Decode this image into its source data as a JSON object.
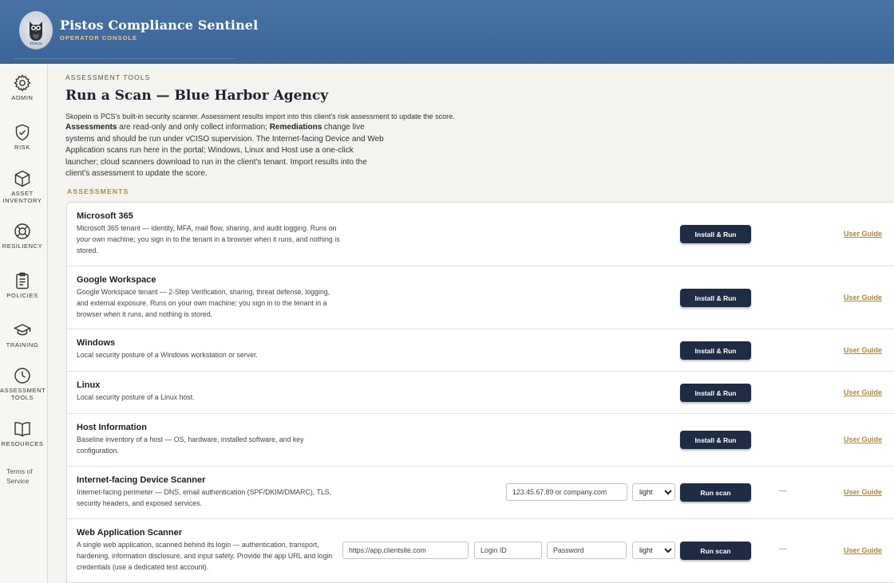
{
  "header": {
    "title": "Pistos Compliance Sentinel",
    "subtitle": "OPERATOR CONSOLE",
    "logo_text": "Pistos"
  },
  "sidebar": {
    "items": [
      {
        "label": "ADMIN",
        "icon": "gear-icon"
      },
      {
        "label": "RISK",
        "icon": "shield-check-icon"
      },
      {
        "label": "ASSET INVENTORY",
        "icon": "cube-icon"
      },
      {
        "label": "RESILIENCY",
        "icon": "lifebuoy-icon"
      },
      {
        "label": "POLICIES",
        "icon": "clipboard-icon"
      },
      {
        "label": "TRAINING",
        "icon": "graduation-cap-icon"
      },
      {
        "label": "ASSESSMENT TOOLS",
        "icon": "clock-icon"
      },
      {
        "label": "RESOURCES",
        "icon": "book-icon"
      }
    ],
    "terms": "Terms of Service"
  },
  "main": {
    "eyebrow": "ASSESSMENT TOOLS",
    "title": "Run a Scan — Blue Harbor Agency",
    "intro_line": "Skopein is PCS's built-in security scanner. Assessment results import into this client's risk assessment to update the score.",
    "intro_b1": "Assessments",
    "intro_t1": " are read-only and only collect information; ",
    "intro_b2": "Remediations",
    "intro_t2": " change live systems and should be run under vCISO supervision. The Internet-facing Device and Web Application scans run here in the portal; Windows, Linux and Host use a one-click launcher; cloud scanners download to run in the client's tenant. Import results into the client's assessment to update the score.",
    "section_label": "ASSESSMENTS",
    "rows": [
      {
        "title": "Microsoft 365",
        "desc": "Microsoft 365 tenant — identity, MFA, mail flow, sharing, and audit logging. Runs on your own machine; you sign in to the tenant in a browser when it runs, and nothing is stored.",
        "button": "Install & Run",
        "guide": "User Guide"
      },
      {
        "title": "Google Workspace",
        "desc": "Google Workspace tenant — 2-Step Verification, sharing, threat defense, logging, and external exposure. Runs on your own machine; you sign in to the tenant in a browser when it runs, and nothing is stored.",
        "button": "Install & Run",
        "guide": "User Guide"
      },
      {
        "title": "Windows",
        "desc": "Local security posture of a Windows workstation or server.",
        "button": "Install & Run",
        "guide": "User Guide"
      },
      {
        "title": "Linux",
        "desc": "Local security posture of a Linux host.",
        "button": "Install & Run",
        "guide": "User Guide"
      },
      {
        "title": "Host Information",
        "desc": "Baseline inventory of a host — OS, hardware, installed software, and key configuration.",
        "button": "Install & Run",
        "guide": "User Guide"
      },
      {
        "title": "Internet-facing Device Scanner",
        "desc": "Internet-facing perimeter — DNS, email authentication (SPF/DKIM/DMARC), TLS, security headers, and exposed services.",
        "button": "Run scan",
        "guide": "User Guide",
        "target_placeholder": "123.45.67.89 or company.com",
        "profile": "light",
        "status": "—"
      },
      {
        "title": "Web Application Scanner",
        "desc": "A single web application, scanned behind its login — authentication, transport, hardening, information disclosure, and input safety. Provide the app URL and login credentials (use a dedicated test account).",
        "button": "Run scan",
        "guide": "User Guide",
        "url_placeholder": "https://app.clientsite.com",
        "login_placeholder": "Login ID",
        "password_placeholder": "Password",
        "profile": "light",
        "status": "—"
      }
    ]
  }
}
